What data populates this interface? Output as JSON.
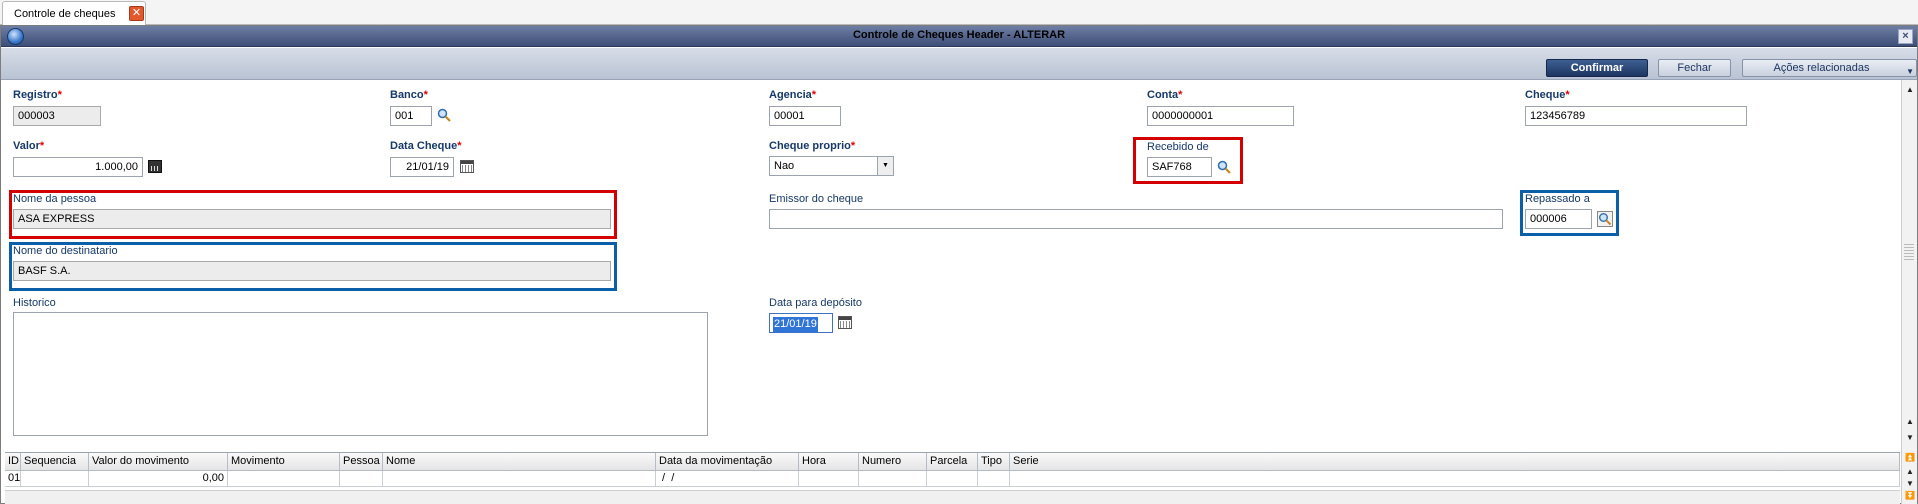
{
  "tab": {
    "label": "Controle de cheques",
    "close_glyph": "✕"
  },
  "window": {
    "title": "Controle de Cheques Header - ALTERAR",
    "close_glyph": "×",
    "icon": "app-globe-icon"
  },
  "toolbar": {
    "confirm_label": "Confirmar",
    "close_label": "Fechar",
    "actions_label": "Ações relacionadas",
    "actions_arrow": "▼"
  },
  "form": {
    "registro": {
      "label": "Registro",
      "value": "000003"
    },
    "banco": {
      "label": "Banco",
      "value": "001"
    },
    "agencia": {
      "label": "Agencia",
      "value": "00001"
    },
    "conta": {
      "label": "Conta",
      "value": "0000000001"
    },
    "cheque": {
      "label": "Cheque",
      "value": "123456789"
    },
    "valor": {
      "label": "Valor",
      "value": "1.000,00"
    },
    "data_cheque": {
      "label": "Data Cheque",
      "value": "21/01/19"
    },
    "cheque_proprio": {
      "label": "Cheque proprio",
      "value": "Nao",
      "arrow": "▼"
    },
    "recebido_de": {
      "label": "Recebido de",
      "value": "SAF768"
    },
    "nome_pessoa": {
      "label": "Nome da pessoa",
      "value": "ASA EXPRESS"
    },
    "emissor": {
      "label": "Emissor do cheque",
      "value": ""
    },
    "repassado_a": {
      "label": "Repassado a",
      "value": "000006"
    },
    "nome_destinatario": {
      "label": "Nome do destinatario",
      "value": "BASF S.A."
    },
    "historico": {
      "label": "Historico",
      "value": ""
    },
    "data_deposito": {
      "label": "Data para depósito",
      "value": "21/01/19"
    },
    "required_mark": "*"
  },
  "grid": {
    "columns": [
      "ID",
      "Sequencia",
      "Valor do movimento",
      "Movimento",
      "Pessoa",
      "Nome",
      "Data da movimentação",
      "Hora",
      "Numero",
      "Parcela",
      "Tipo",
      "Serie"
    ],
    "rows": [
      [
        "01",
        "",
        "0,00",
        "",
        "",
        "",
        " /  /",
        "",
        "",
        "",
        "",
        ""
      ]
    ]
  },
  "scrollbar": {
    "up": "▲",
    "down": "▼",
    "top": "⏫",
    "bottom": "⏬"
  },
  "colors": {
    "title_bar": "#3d4e78",
    "confirm_button": "#1d3561",
    "label": "#15396a",
    "required": "#e00000",
    "highlight_red": "#d40000",
    "highlight_blue": "#0b5fa8"
  }
}
